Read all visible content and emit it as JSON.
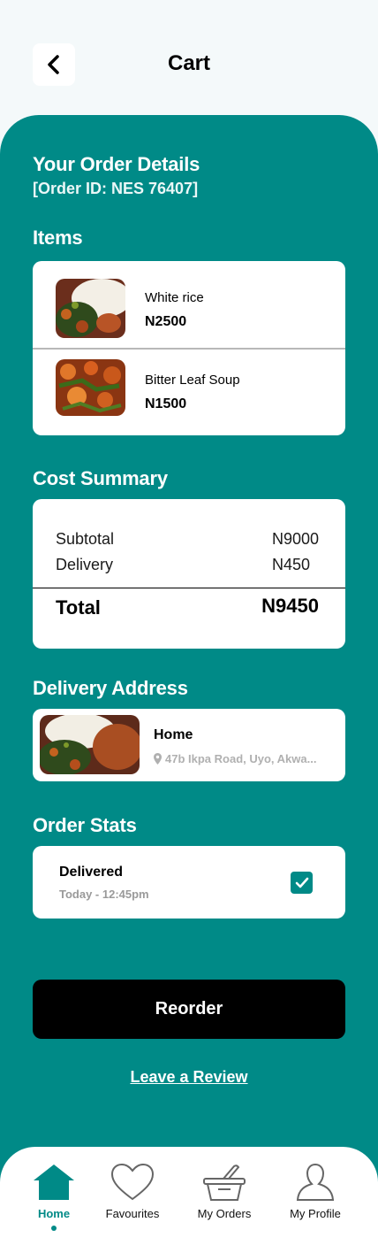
{
  "header": {
    "title": "Cart",
    "back_icon": "chevron-left-icon"
  },
  "order": {
    "heading": "Your Order Details",
    "id_text": "[Order ID: NES 76407]"
  },
  "items_section": {
    "title": "Items",
    "items": [
      {
        "name": "White rice",
        "price": "N2500"
      },
      {
        "name": "Bitter Leaf Soup",
        "price": "N1500"
      }
    ]
  },
  "cost_summary": {
    "title": "Cost Summary",
    "subtotal_label": "Subtotal",
    "subtotal_value": "N9000",
    "delivery_label": "Delivery",
    "delivery_value": "N450",
    "total_label": "Total",
    "total_value": "N9450"
  },
  "delivery_address": {
    "title": "Delivery Address",
    "name": "Home",
    "address": "47b Ikpa Road, Uyo, Akwa...",
    "icon": "map-pin-icon"
  },
  "order_stats": {
    "title": "Order Stats",
    "status": "Delivered",
    "time": "Today - 12:45pm",
    "checked": true
  },
  "actions": {
    "reorder": "Reorder",
    "review": "Leave a Review"
  },
  "nav": {
    "items": [
      {
        "label": "Home",
        "icon": "home-icon",
        "active": true
      },
      {
        "label": "Favourites",
        "icon": "heart-icon",
        "active": false
      },
      {
        "label": "My Orders",
        "icon": "basket-icon",
        "active": false
      },
      {
        "label": "My Profile",
        "icon": "profile-icon",
        "active": false
      }
    ]
  },
  "colors": {
    "accent": "#008a87",
    "background": "#f4f9fa",
    "button": "#000000"
  }
}
